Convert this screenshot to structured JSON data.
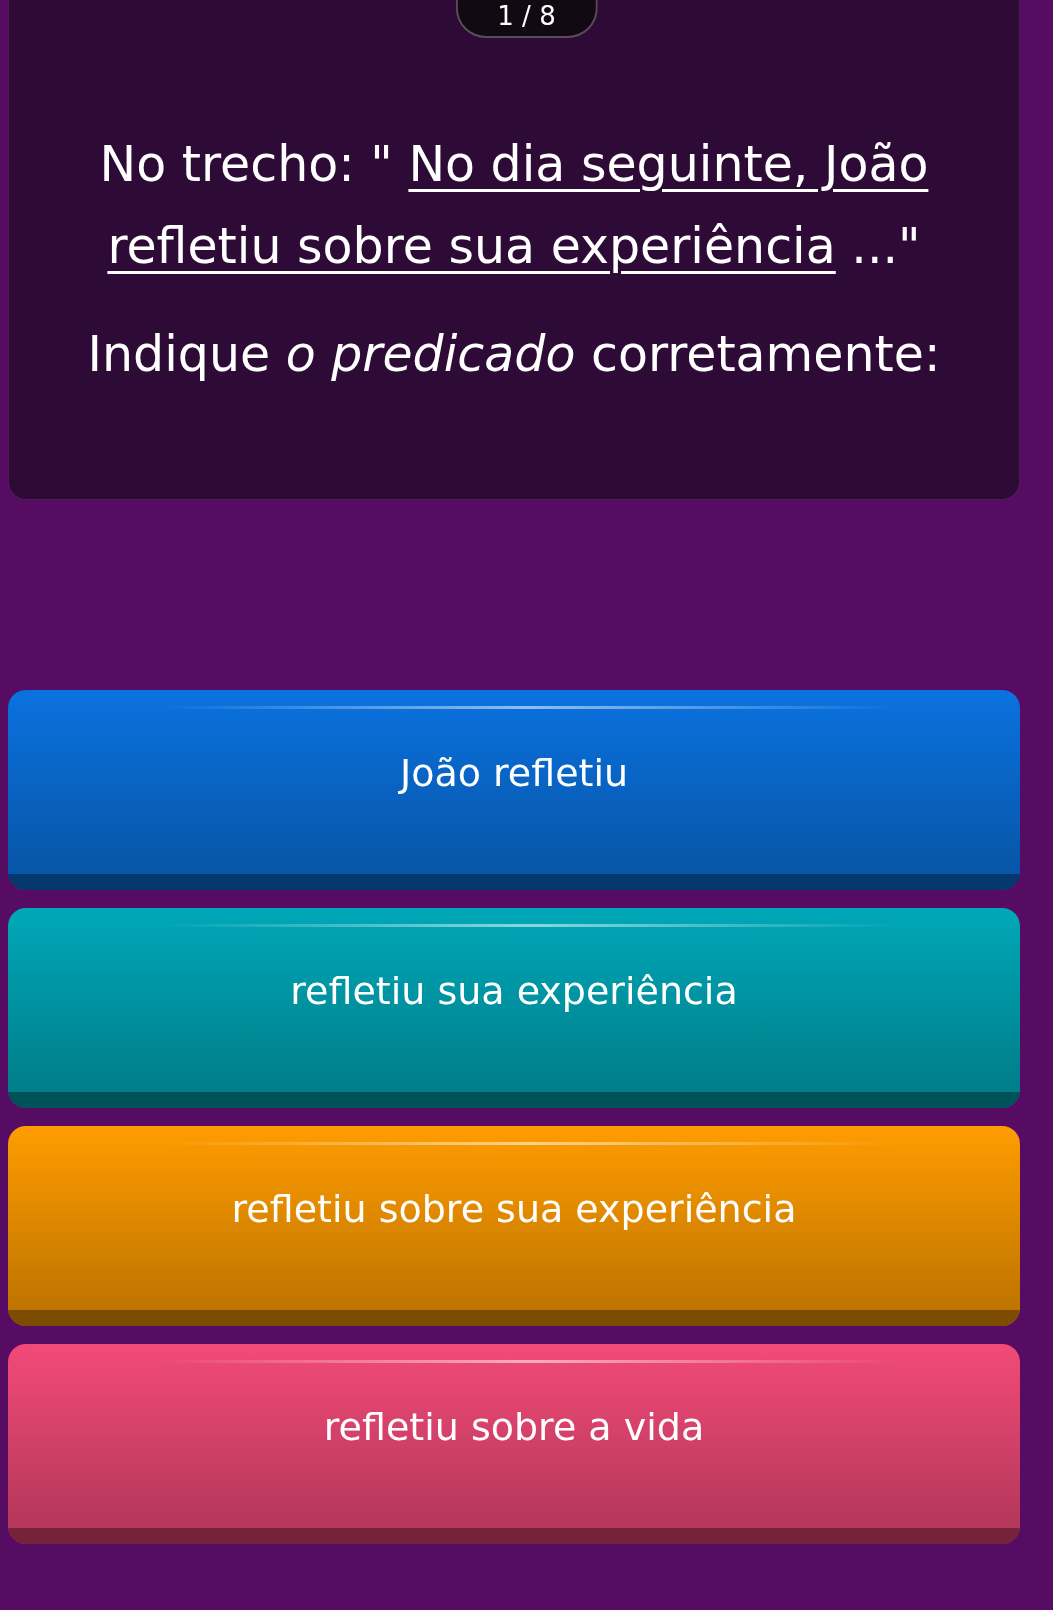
{
  "counter": "1 / 8",
  "question": {
    "lead": "No trecho: \" ",
    "quote": "No dia seguinte, João refletiu sobre sua experiência",
    "tail": " ...\"",
    "instruction": "Indique *o predicado* corretamente:"
  },
  "answers": [
    {
      "label": "João refletiu",
      "color": "#0a72e0"
    },
    {
      "label": "refletiu sua experiência",
      "color": "#00a8b8"
    },
    {
      "label": "refletiu sobre sua experiência",
      "color": "#ff9c00"
    },
    {
      "label": "refletiu sobre a vida",
      "color": "#f24a78"
    }
  ]
}
